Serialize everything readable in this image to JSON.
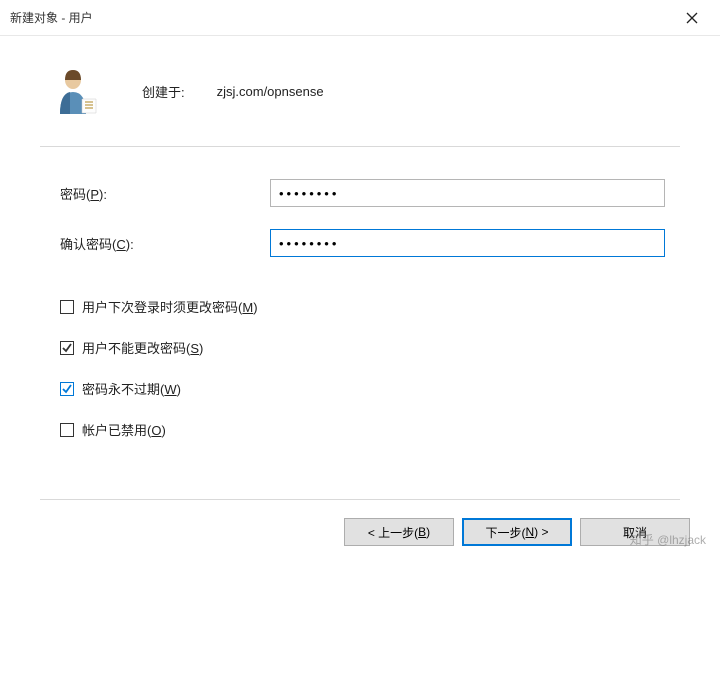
{
  "title": "新建对象 - 用户",
  "header": {
    "created_label": "创建于:",
    "created_value": "zjsj.com/opnsense"
  },
  "form": {
    "password_label_pre": "密码(",
    "password_label_key": "P",
    "password_label_post": "):",
    "password_value": "••••••••",
    "confirm_label_pre": "确认密码(",
    "confirm_label_key": "C",
    "confirm_label_post": "):",
    "confirm_value": "••••••••"
  },
  "checks": {
    "must_change_pre": "用户下次登录时须更改密码(",
    "must_change_key": "M",
    "must_change_post": ")",
    "must_change_checked": false,
    "cannot_change_pre": "用户不能更改密码(",
    "cannot_change_key": "S",
    "cannot_change_post": ")",
    "cannot_change_checked": true,
    "never_expire_pre": "密码永不过期(",
    "never_expire_key": "W",
    "never_expire_post": ")",
    "never_expire_checked": true,
    "disabled_pre": "帐户已禁用(",
    "disabled_key": "O",
    "disabled_post": ")",
    "disabled_checked": false
  },
  "buttons": {
    "back_pre": "< 上一步(",
    "back_key": "B",
    "back_post": ")",
    "next_pre": "下一步(",
    "next_key": "N",
    "next_post": ") >",
    "cancel": "取消"
  },
  "watermark": "知乎 @lhzjack"
}
